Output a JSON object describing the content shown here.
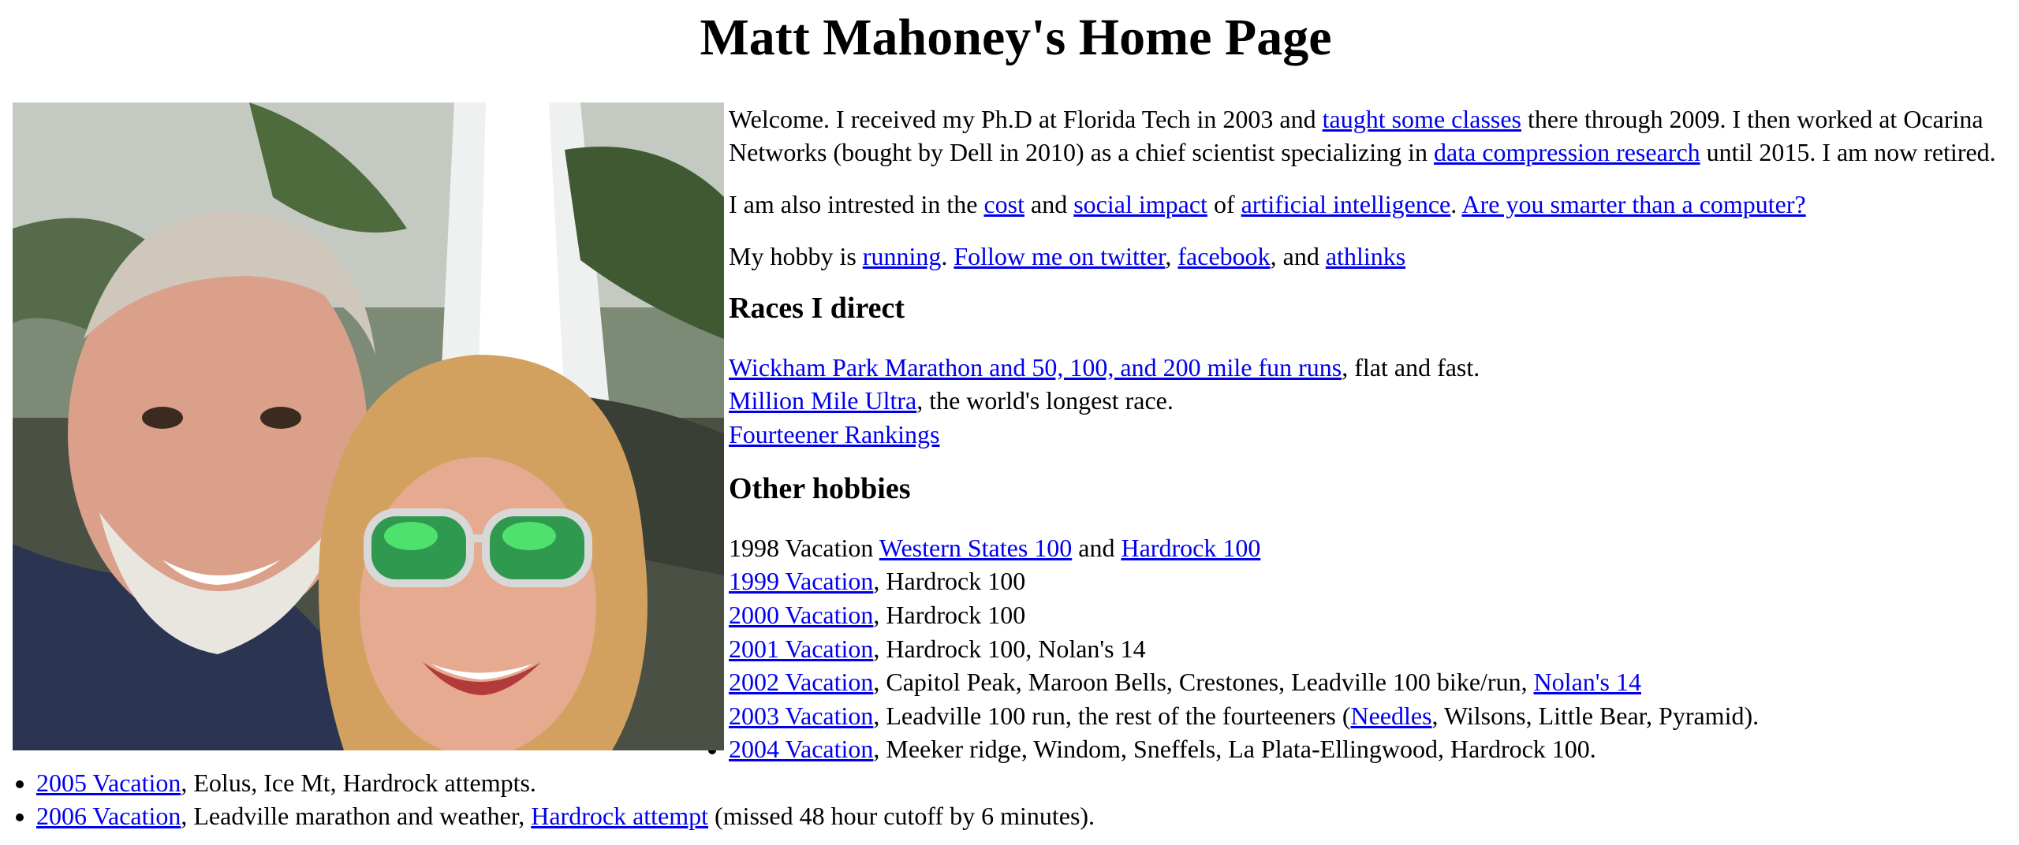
{
  "page": {
    "title": "Matt Mahoney's Home Page"
  },
  "intro": {
    "p1": [
      "Welcome. I received my Ph.D at Florida Tech in 2003 and ",
      "taught some classes",
      " there through 2009. I then worked at Ocarina Networks (bought by Dell in 2010) as a chief scientist specializing in ",
      "data compression research",
      " until 2015. I am now retired."
    ],
    "p2": [
      "I am also intrested in the ",
      "cost",
      " and ",
      "social impact",
      " of ",
      "artificial intelligence",
      ". ",
      "Are you smarter than a computer?"
    ],
    "p3": [
      "My hobby is ",
      "running",
      ". ",
      "Follow me on twitter",
      ", ",
      "facebook",
      ", and ",
      "athlinks"
    ]
  },
  "races": {
    "heading": "Races I direct",
    "items": [
      {
        "link": "Wickham Park Marathon and 50, 100, and 200 mile fun runs",
        "text": ", flat and fast."
      },
      {
        "link": "Million Mile Ultra",
        "text": ", the world's longest race."
      },
      {
        "link": "Fourteener Rankings",
        "text": ""
      }
    ]
  },
  "hobbies": {
    "heading": "Other hobbies",
    "items": [
      {
        "pre": "1998 Vacation ",
        "link1": "Western States 100",
        "mid": " and ",
        "link2": "Hardrock 100",
        "post": ""
      },
      {
        "link": "1999 Vacation",
        "text": ", Hardrock 100"
      },
      {
        "link": "2000 Vacation",
        "text": ", Hardrock 100"
      },
      {
        "link": "2001 Vacation",
        "text": ", Hardrock 100, Nolan's 14"
      },
      {
        "link": "2002 Vacation",
        "text": ", Capitol Peak, Maroon Bells, Crestones, Leadville 100 bike/run, ",
        "link2": "Nolan's 14"
      },
      {
        "link": "2003 Vacation",
        "text": ", Leadville 100 run, the rest of the fourteeners (",
        "link2": "Needles",
        "text2": ", Wilsons, Little Bear, Pyramid)."
      },
      {
        "link": "2004 Vacation",
        "text": ", Meeker ridge, Windom, Sneffels, La Plata-Ellingwood, Hardrock 100."
      },
      {
        "link": "2005 Vacation",
        "text": ", Eolus, Ice Mt, Hardrock attempts."
      },
      {
        "link": "2006 Vacation",
        "text": ", Leadville marathon and weather, ",
        "link2": "Hardrock attempt",
        "text2": " (missed 48 hour cutoff by 6 minutes)."
      }
    ]
  }
}
